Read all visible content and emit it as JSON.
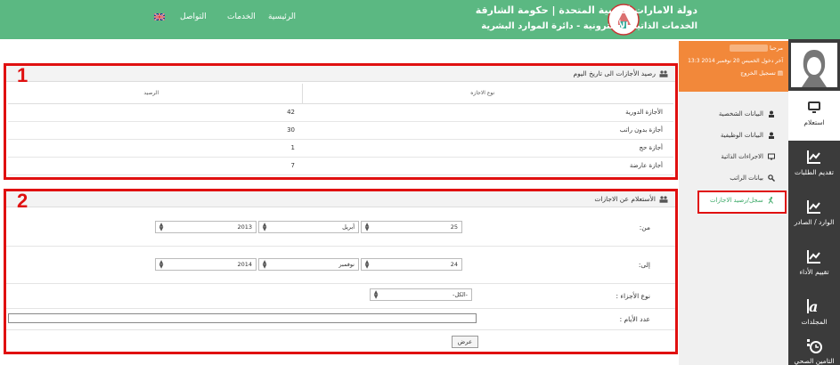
{
  "header": {
    "gov_title": "دولة الامارات العربية المتحدة | حكومة الشارقة",
    "gov_subtitle": "الخدمات الذاتية الألكترونية - دائرة الموارد البشرية",
    "nav": {
      "home": "الرئيسية",
      "services": "الخدمات",
      "contact": "التواصل"
    },
    "language_icon": "uk-flag-icon"
  },
  "user_box": {
    "welcome": "مرحبا",
    "last_login": "آخر دخول الخميس 20 نوفمبر 2014 13:3",
    "logout": "تسجيل الخروج"
  },
  "right_sidebar": {
    "items": [
      {
        "label": "استعلام",
        "icon": "monitor-icon"
      },
      {
        "label": "تقديم الطلبات",
        "icon": "chart-icon"
      },
      {
        "label": "الوارد / الصادر",
        "icon": "chart-icon"
      },
      {
        "label": "تقييم الأداء",
        "icon": "chart-icon"
      },
      {
        "label": "المجلدات",
        "icon": "font-icon"
      },
      {
        "label": "التامين الصحي",
        "icon": "clock-icon"
      }
    ]
  },
  "side_menu": {
    "items": [
      {
        "label": "البيانات الشخصية",
        "icon": "user-icon"
      },
      {
        "label": "البيانات الوظيفية",
        "icon": "user-icon"
      },
      {
        "label": "الاجراءات الذاتية",
        "icon": "monitor-icon"
      },
      {
        "label": "بيانات الراتب",
        "icon": "search-icon"
      }
    ],
    "active": {
      "label": "سجل/رصيد الاجازات",
      "icon": "run-icon"
    }
  },
  "panel1": {
    "number": "1",
    "title": "رصيد الأجازات الى تاريخ اليوم",
    "columns": {
      "type": "نوع الاجازه",
      "balance": "الرصيد"
    },
    "rows": [
      {
        "type": "الأجازة الدورية",
        "balance": "42"
      },
      {
        "type": "أجازة بدون راتب",
        "balance": "30"
      },
      {
        "type": "أجازة حج",
        "balance": "1"
      },
      {
        "type": "أجازة عارضة",
        "balance": "7"
      }
    ]
  },
  "panel2": {
    "number": "2",
    "title": "الأستعلام عن الاجازات",
    "from_label": "من:",
    "to_label": "إلى:",
    "from": {
      "day": "25",
      "month": "أبريل",
      "year": "2013"
    },
    "to": {
      "day": "24",
      "month": "نوفمبر",
      "year": "2014"
    },
    "leave_type_label": "نوع الأجزاء :",
    "leave_type_value": "-الكل-",
    "days_label": "عدد الأيام :",
    "show_button": "عرض"
  },
  "colors": {
    "header_green": "#5bb882",
    "accent_orange": "#f2883a",
    "highlight_red": "#e01010",
    "sidebar_dark": "#3b3b3b"
  }
}
